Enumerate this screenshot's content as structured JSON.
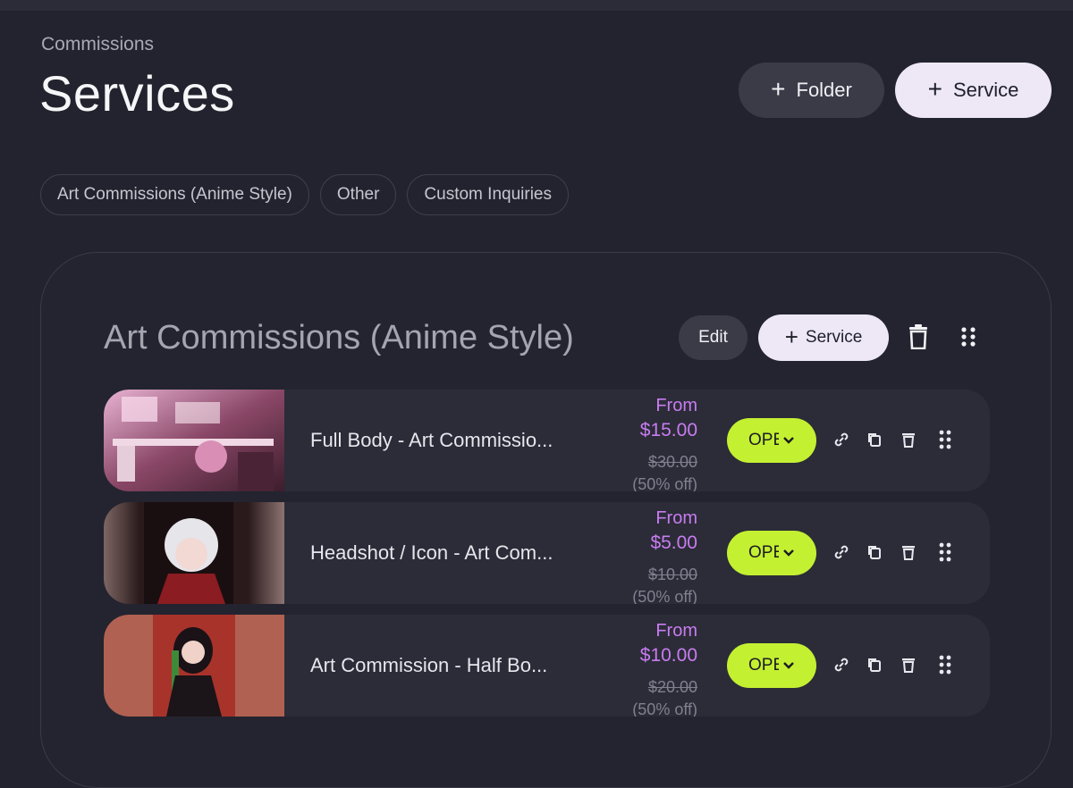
{
  "breadcrumb": "Commissions",
  "page_title": "Services",
  "header_buttons": {
    "folder": "Folder",
    "service": "Service"
  },
  "filters": [
    "Art Commissions (Anime Style)",
    "Other",
    "Custom Inquiries"
  ],
  "folder": {
    "title": "Art Commissions (Anime Style)",
    "edit_label": "Edit",
    "service_label": "Service"
  },
  "services": [
    {
      "name": "Full Body - Art Commissio...",
      "from": "From",
      "price": "$15.00",
      "old_price": "$30.00",
      "discount": "(50% off)",
      "status": "OPEN"
    },
    {
      "name": "Headshot / Icon - Art Com...",
      "from": "From",
      "price": "$5.00",
      "old_price": "$10.00",
      "discount": "(50% off)",
      "status": "OPEN"
    },
    {
      "name": "Art Commission - Half Bo...",
      "from": "From",
      "price": "$10.00",
      "old_price": "$20.00",
      "discount": "(50% off)",
      "status": "OPEN"
    }
  ],
  "colors": {
    "accent_lime": "#c4f032",
    "price_purple": "#c97cf0",
    "bg": "#22232e"
  },
  "icons": [
    "plus-icon",
    "trash-icon",
    "drag-handle-icon",
    "link-icon",
    "copy-icon",
    "chevron-down-icon"
  ]
}
